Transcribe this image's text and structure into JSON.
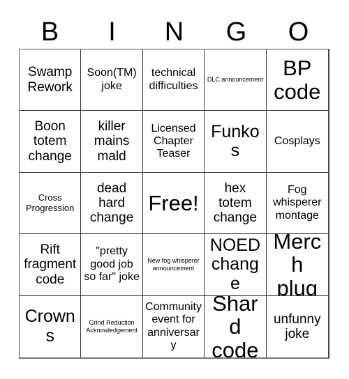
{
  "card": {
    "header_letters": [
      "B",
      "I",
      "N",
      "G",
      "O"
    ],
    "free_space_index": 12,
    "colors": {
      "background": "#ffffff",
      "text": "#000000",
      "gridline": "#333333",
      "outer_border": "#555555"
    },
    "cells": [
      {
        "text": "Swamp Rework",
        "size": "s-lg"
      },
      {
        "text": "Soon(TM) joke",
        "size": "s-md"
      },
      {
        "text": "technical difficulties",
        "size": "s-md"
      },
      {
        "text": "DLC announcement",
        "size": "s-xs"
      },
      {
        "text": "BP code",
        "size": "s-xxl"
      },
      {
        "text": "Boon totem change",
        "size": "s-lg"
      },
      {
        "text": "killer mains mald",
        "size": "s-lg"
      },
      {
        "text": "Licensed Chapter Teaser",
        "size": "s-md"
      },
      {
        "text": "Funkos",
        "size": "s-xl"
      },
      {
        "text": "Cosplays",
        "size": "s-md"
      },
      {
        "text": "Cross Progression",
        "size": "s-sm"
      },
      {
        "text": "dead hard change",
        "size": "s-lg"
      },
      {
        "text": "Free!",
        "size": "s-xxl"
      },
      {
        "text": "hex totem change",
        "size": "s-lg"
      },
      {
        "text": "Fog whisperer montage",
        "size": "s-md"
      },
      {
        "text": "Rift fragment code",
        "size": "s-lg"
      },
      {
        "text": "\"pretty good job so far\" joke",
        "size": "s-md"
      },
      {
        "text": "New fog whisperer announcement",
        "size": "s-xs"
      },
      {
        "text": "NOED change",
        "size": "s-xl"
      },
      {
        "text": "Merch plug",
        "size": "s-xxl"
      },
      {
        "text": "Crowns",
        "size": "s-xl"
      },
      {
        "text": "Grind Reduction Acknowledgement",
        "size": "s-xs"
      },
      {
        "text": "Community event for anniversary",
        "size": "s-md"
      },
      {
        "text": "Shard code",
        "size": "s-xxl"
      },
      {
        "text": "unfunny joke",
        "size": "s-lg"
      }
    ]
  }
}
